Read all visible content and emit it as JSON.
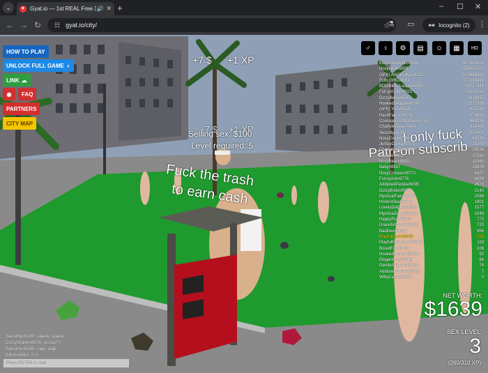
{
  "browser": {
    "tab_title": "Gyat.io — 1st REAL Free 3D",
    "url": "gyat.io/city/",
    "incognito_label": "Incognito (2)"
  },
  "menu": {
    "how_to_play": "HOW TO PLAY",
    "unlock": "UNLOCK FULL GAME",
    "link": "LINK",
    "faq": "FAQ",
    "partners": "PARTNERS",
    "city_map": "CITY MAP"
  },
  "hud": {
    "reward_cash_top": "+7 $",
    "reward_xp_top": "+1 XP",
    "reward_cash_mid": "+7 $",
    "reward_xp_mid": "+1 XP",
    "selling_sex": "Selling sex: $100",
    "level_required": "Level required: 5",
    "tip_line1": "Fuck the trash",
    "tip_line2": "to earn cash",
    "billboard_line1": "I only fuck",
    "billboard_line2": "Patreon subscrib",
    "net_worth_label": "NET WORTH:",
    "net_worth_value": "$1639",
    "sex_level_label": "SEX LEVEL:",
    "sex_level_value": "3",
    "xp_progress": "(260/310 XP)",
    "xp_fraction": 0.839
  },
  "leaderboard": [
    {
      "name": "ElegantDolphin#8982",
      "score": "887943654"
    },
    {
      "name": "NosyWolf#8991",
      "score": "558091557"
    },
    {
      "name": "(AFK) ANGELIKA#8322",
      "score": "109896965"
    },
    {
      "name": "FUN.GIRL#8011",
      "score": "57699436"
    },
    {
      "name": "BOOBIEKA.expo#8983",
      "score": "19757341"
    },
    {
      "name": "Fun.girl.city#9021",
      "score": "10159292"
    },
    {
      "name": "DizzyBella#8580",
      "score": "2918967"
    },
    {
      "name": "HookedSeagull#9009",
      "score": "2337069"
    },
    {
      "name": "(AFK) Yuri#8918",
      "score": "651599"
    },
    {
      "name": "HashFalcon#8742",
      "score": "579856"
    },
    {
      "name": "CourageousWoman#8719",
      "score": "480036"
    },
    {
      "name": "ChattyMoose#7848",
      "score": "315408"
    },
    {
      "name": "Security#8280",
      "score": "182401"
    },
    {
      "name": "NosyCow#8744",
      "score": "69780"
    },
    {
      "name": "JumpyCobra#8779",
      "score": "26200"
    },
    {
      "name": "CharmingAnt#8969",
      "score": "18024"
    },
    {
      "name": "Sheep#8951",
      "score": "17590"
    },
    {
      "name": "NosyBear#8882",
      "score": "15365"
    },
    {
      "name": "Baby#8957",
      "score": "13609"
    },
    {
      "name": "NosyChicken#8772",
      "score": "6427"
    },
    {
      "name": "FunnyAnt#8776",
      "score": "4699"
    },
    {
      "name": "AddictedPanda#9005",
      "score": "2678"
    },
    {
      "name": "DizzyBride#8976",
      "score": "2140"
    },
    {
      "name": "MysticalFairy#8906",
      "score": "2086"
    },
    {
      "name": "HonestSeal#9018",
      "score": "1801"
    },
    {
      "name": "LovelyDolphin#9033",
      "score": "1577"
    },
    {
      "name": "MysticalZebra#9019",
      "score": "1049"
    },
    {
      "name": "HappyFish#8915",
      "score": "773"
    },
    {
      "name": "GracefulWhale#9012",
      "score": "720"
    },
    {
      "name": "BadDeer#8932",
      "score": "456"
    },
    {
      "name": "PlayfulDuck#9038",
      "score": "259",
      "me": true
    },
    {
      "name": "PlayfulPolarBear#9040",
      "score": "119"
    },
    {
      "name": "BoredFish#9034",
      "score": "106"
    },
    {
      "name": "HookedWoman#9037",
      "score": "92"
    },
    {
      "name": "ElegantFox#8943",
      "score": "84"
    },
    {
      "name": "GentleAlligator#9022",
      "score": "74"
    },
    {
      "name": "AddictedGorilla#8920",
      "score": "7"
    },
    {
      "name": "WittyCamel#9039",
      "score": "0"
    }
  ],
  "chat": [
    {
      "user": "Security#8280:",
      "msg": "spank, spank"
    },
    {
      "user": "DizzyShark#8976:",
      "msg": "russia??"
    },
    {
      "user": "Security#8280:",
      "msg": "slap, slap"
    },
    {
      "user": "PINX#8562:",
      "msg": "0.0"
    }
  ],
  "chat_placeholder": "Press ENTER to chat",
  "colors": {
    "blue_button": "#1565c0",
    "red_button": "#d32f2f",
    "yellow_button": "#f5c400",
    "grass": "#1f9a2e",
    "highlight_player": "#ffd800"
  }
}
